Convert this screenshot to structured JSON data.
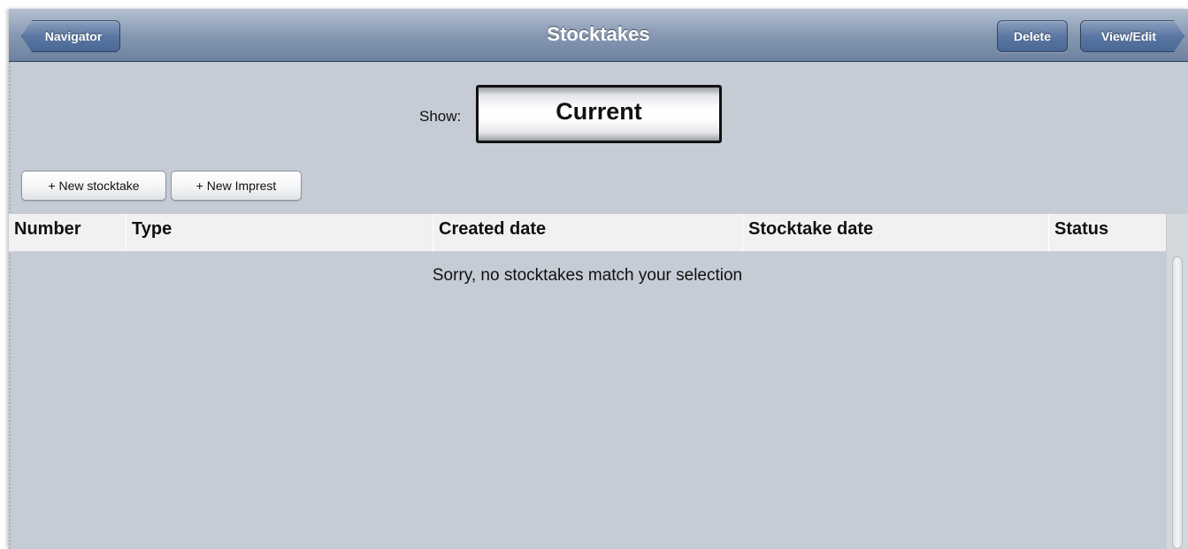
{
  "navbar": {
    "title": "Stocktakes",
    "back_label": "Navigator",
    "delete_label": "Delete",
    "view_edit_label": "View/Edit"
  },
  "filter": {
    "label": "Show:",
    "selected": "Current"
  },
  "actions": {
    "new_stocktake": "+ New stocktake",
    "new_imprest": "+ New Imprest"
  },
  "table": {
    "columns": [
      "Number",
      "Type",
      "Created date",
      "Stocktake date",
      "Status"
    ],
    "empty_message": "Sorry, no stocktakes match your selection"
  },
  "colors": {
    "navbar": "#6d82a1",
    "background": "#c5ccd5",
    "header_row": "#f1f1f2"
  }
}
